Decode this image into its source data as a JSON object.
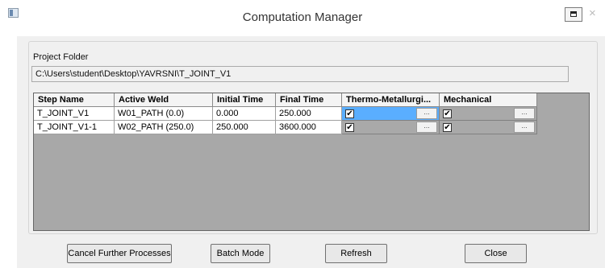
{
  "window": {
    "title": "Computation Manager",
    "close_glyph": "×"
  },
  "project_folder": {
    "label": "Project Folder",
    "value": "C:\\Users\\student\\Desktop\\YAVRSNI\\T_JOINT_V1"
  },
  "table": {
    "columns": [
      "Step Name",
      "Active Weld",
      "Initial Time",
      "Final Time",
      "Thermo-Metallurgi...",
      "Mechanical"
    ],
    "rows": [
      {
        "step_name": "T_JOINT_V1",
        "active_weld": "W01_PATH (0.0)",
        "initial_time": "0.000",
        "final_time": "250.000",
        "thermo_checked": true,
        "mechanical_checked": true
      },
      {
        "step_name": "T_JOINT_V1-1",
        "active_weld": "W02_PATH (250.0)",
        "initial_time": "250.000",
        "final_time": "3600.000",
        "thermo_checked": true,
        "mechanical_checked": true
      }
    ],
    "check_glyph": "✔",
    "ellipsis_label": "..."
  },
  "buttons": {
    "cancel": "Cancel Further Processes",
    "batch": "Batch Mode",
    "refresh": "Refresh",
    "close": "Close"
  },
  "colors": {
    "selected_cell": "#5aaeff",
    "checkbox_cell": "#a9a9a9"
  },
  "icons": [
    "app-icon",
    "restore-icon",
    "close-icon"
  ]
}
